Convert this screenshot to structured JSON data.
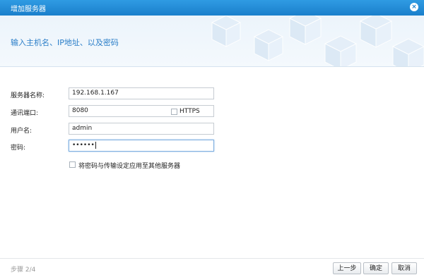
{
  "dialog": {
    "title": "增加服务器",
    "close_icon": "×"
  },
  "banner": {
    "heading": "输入主机名、IP地址、以及密码"
  },
  "form": {
    "server_name_label": "服务器名称:",
    "server_name_value": "192.168.1.167",
    "port_label": "通讯端口:",
    "port_value": "8080",
    "https_label": "HTTPS",
    "username_label": "用户名:",
    "username_value": "admin",
    "password_label": "密码:",
    "password_mask": "••••••",
    "apply_all_label": "将密码与传输设定应用至其他服务器"
  },
  "footer": {
    "step": "步骤 2/4",
    "prev_label": "上一步",
    "ok_label": "确定",
    "cancel_label": "取消"
  }
}
